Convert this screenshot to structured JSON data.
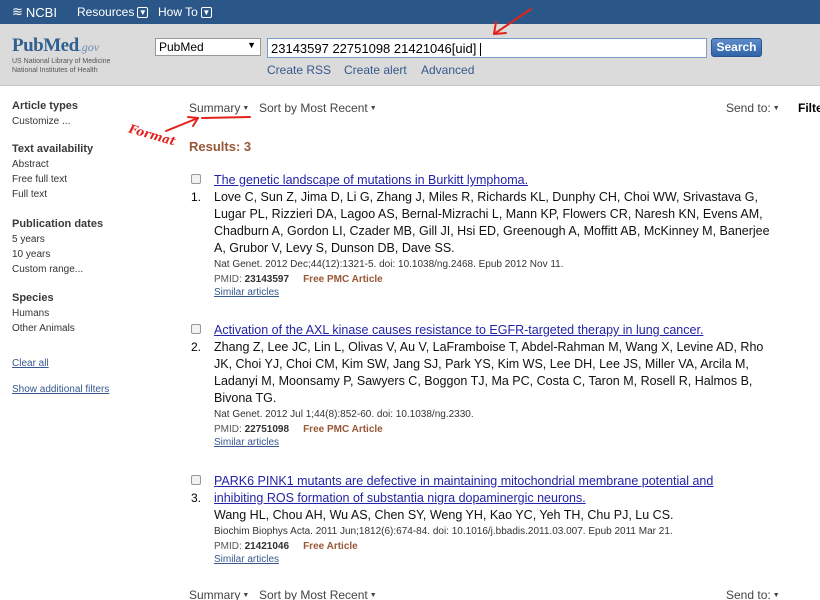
{
  "topbar": {
    "logo": "NCBI",
    "menus": [
      "Resources",
      "How To"
    ]
  },
  "header": {
    "logo_main": "PubMed",
    "logo_suffix": ".gov",
    "logo_line1": "US National Library of Medicine",
    "logo_line2": "National Institutes of Health",
    "database": "PubMed",
    "query": "23143597 22751098 21421046[uid]",
    "search_label": "Search",
    "links": [
      "Create RSS",
      "Create alert",
      "Advanced"
    ]
  },
  "sidebar": {
    "groups": [
      {
        "heading": "Article types",
        "items": [
          "Customize ..."
        ]
      },
      {
        "heading": "Text availability",
        "items": [
          "Abstract",
          "Free full text",
          "Full text"
        ]
      },
      {
        "heading": "Publication dates",
        "items": [
          "5 years",
          "10 years",
          "Custom range..."
        ]
      },
      {
        "heading": "Species",
        "items": [
          "Humans",
          "Other Animals"
        ]
      }
    ],
    "clear_all": "Clear all",
    "show_filters": "Show additional filters"
  },
  "toolbar": {
    "format": "Summary",
    "sort": "Sort by Most Recent",
    "send_to": "Send to:",
    "filters": "Filte"
  },
  "results_label": "Results: 3",
  "annotation": {
    "label": "Format",
    "color": "#e3231b"
  },
  "results": [
    {
      "number": "1.",
      "title": "The genetic landscape of mutations in Burkitt lymphoma.",
      "authors": [
        "Love C, Sun Z, Jima D, Li G, Zhang J, Miles R, Richards KL, Dunphy CH, Choi WW, Srivastava G,",
        "Lugar PL, Rizzieri DA, Lagoo AS, Bernal-Mizrachi L, Mann KP, Flowers CR, Naresh KN, Evens AM,",
        "Chadburn A, Gordon LI, Czader MB, Gill JI, Hsi ED, Greenough A, Moffitt AB, McKinney M, Banerjee",
        "A, Grubor V, Levy S, Dunson DB, Dave SS."
      ],
      "citation": "Nat Genet. 2012 Dec;44(12):1321-5. doi: 10.1038/ng.2468. Epub 2012 Nov 11.",
      "pmid_label": "PMID:",
      "pmid": "23143597",
      "free": "Free PMC Article",
      "similar": "Similar articles"
    },
    {
      "number": "2.",
      "title": "Activation of the AXL kinase causes resistance to EGFR-targeted therapy in lung cancer.",
      "authors": [
        "Zhang Z, Lee JC, Lin L, Olivas V, Au V, LaFramboise T, Abdel-Rahman M, Wang X, Levine AD, Rho",
        "JK, Choi YJ, Choi CM, Kim SW, Jang SJ, Park YS, Kim WS, Lee DH, Lee JS, Miller VA, Arcila M,",
        "Ladanyi M, Moonsamy P, Sawyers C, Boggon TJ, Ma PC, Costa C, Taron M, Rosell R, Halmos B,",
        "Bivona TG."
      ],
      "citation": "Nat Genet. 2012 Jul 1;44(8):852-60. doi: 10.1038/ng.2330.",
      "pmid_label": "PMID:",
      "pmid": "22751098",
      "free": "Free PMC Article",
      "similar": "Similar articles"
    },
    {
      "number": "3.",
      "title_lines": [
        "PARK6 PINK1 mutants are defective in maintaining mitochondrial membrane potential and",
        "inhibiting ROS formation of substantia nigra dopaminergic neurons."
      ],
      "authors": [
        "Wang HL, Chou AH, Wu AS, Chen SY, Weng YH, Kao YC, Yeh TH, Chu PJ, Lu CS."
      ],
      "citation": "Biochim Biophys Acta. 2011 Jun;1812(6):674-84. doi: 10.1016/j.bbadis.2011.03.007. Epub 2011 Mar 21.",
      "pmid_label": "PMID:",
      "pmid": "21421046",
      "free": "Free Article",
      "similar": "Similar articles"
    }
  ]
}
